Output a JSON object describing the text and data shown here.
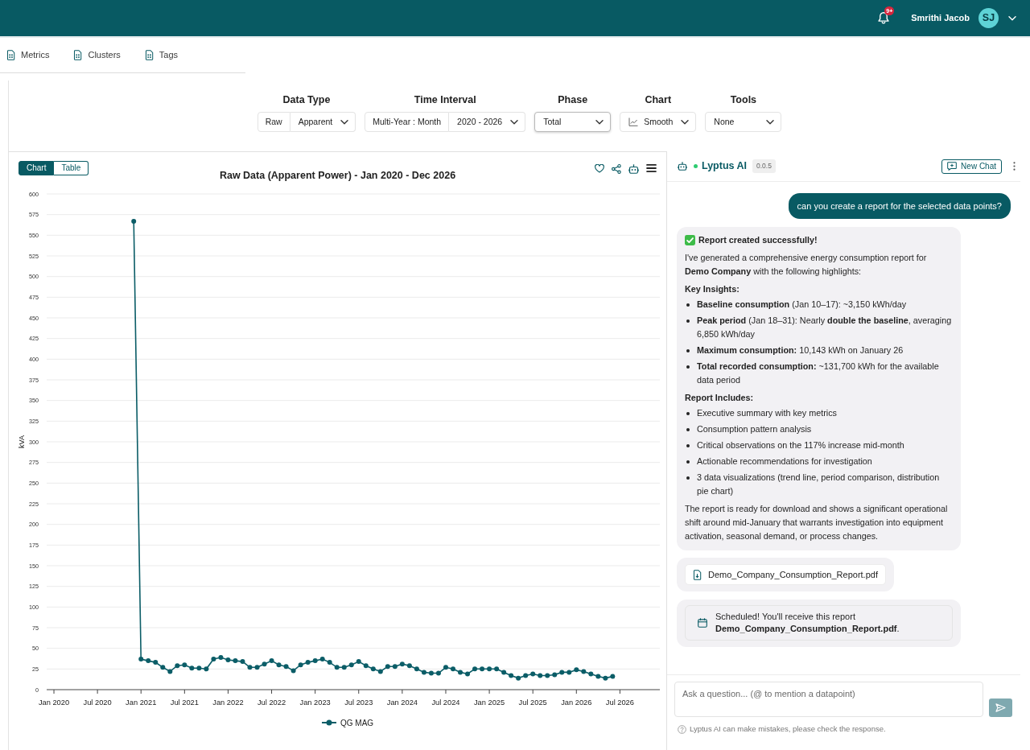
{
  "header": {
    "notification_count": "9+",
    "user_name": "Smrithi Jacob",
    "avatar_initials": "SJ"
  },
  "nav_tabs": [
    {
      "label": "Metrics"
    },
    {
      "label": "Clusters"
    },
    {
      "label": "Tags"
    }
  ],
  "filters": [
    {
      "label": "Data Type",
      "controls": [
        {
          "kind": "label",
          "text": "Raw"
        },
        {
          "kind": "select",
          "text": "Apparent",
          "focused": false
        }
      ]
    },
    {
      "label": "Time Interval",
      "controls": [
        {
          "kind": "label",
          "text": "Multi-Year : Month"
        },
        {
          "kind": "select",
          "text": "2020 - 2026",
          "focused": false
        }
      ]
    },
    {
      "label": "Phase",
      "controls": [
        {
          "kind": "select",
          "text": "Total",
          "focused": true
        }
      ]
    },
    {
      "label": "Chart",
      "controls": [
        {
          "kind": "chart-select",
          "text": "Smooth",
          "focused": false
        }
      ]
    },
    {
      "label": "Tools",
      "controls": [
        {
          "kind": "select",
          "text": "None",
          "focused": false
        }
      ]
    }
  ],
  "chart_panel": {
    "view_toggle": [
      {
        "label": "Chart",
        "selected": true
      },
      {
        "label": "Table",
        "selected": false
      }
    ],
    "chart_data": {
      "type": "line",
      "title": "Raw Data (Apparent Power) - Jan 2020 - Dec 2026",
      "ylabel": "kVA",
      "grid": true,
      "categories": [
        "Jan 2020",
        null,
        null,
        null,
        null,
        null,
        "Jul 2020",
        null,
        null,
        null,
        null,
        null,
        "Jan 2021",
        null,
        null,
        null,
        null,
        null,
        "Jul 2021",
        null,
        null,
        null,
        null,
        null,
        "Jan 2022",
        null,
        null,
        null,
        null,
        null,
        "Jul 2022",
        null,
        null,
        null,
        null,
        null,
        "Jan 2023",
        null,
        null,
        null,
        null,
        null,
        "Jul 2023",
        null,
        null,
        null,
        null,
        null,
        "Jan 2024",
        null,
        null,
        null,
        null,
        null,
        "Jul 2024",
        null,
        null,
        null,
        null,
        null,
        "Jan 2025",
        null,
        null,
        null,
        null,
        null,
        "Jul 2025",
        null,
        null,
        null,
        null,
        null,
        "Jan 2026",
        null,
        null,
        null,
        null,
        null,
        "Jul 2026"
      ],
      "ylim": [
        0,
        600
      ],
      "yticks": [
        0,
        25,
        50,
        75,
        100,
        125,
        150,
        175,
        200,
        225,
        250,
        275,
        300,
        325,
        350,
        375,
        400,
        425,
        450,
        475,
        500,
        525,
        550,
        575,
        600
      ],
      "series": [
        {
          "name": "QG MAG",
          "color": "#0b5d67",
          "marker": "circle",
          "values": [
            null,
            null,
            null,
            null,
            null,
            null,
            null,
            null,
            null,
            null,
            null,
            567,
            37,
            35,
            33,
            27,
            22,
            29,
            30,
            26,
            26,
            25,
            37,
            39,
            36,
            35,
            34,
            27,
            27,
            31,
            35,
            30,
            28,
            23,
            30,
            33,
            35,
            37,
            33,
            27,
            27,
            30,
            34,
            29,
            25,
            22,
            28,
            28,
            31,
            29,
            25,
            21,
            20,
            20,
            27,
            25,
            21,
            19,
            25,
            25,
            25,
            25,
            21,
            17,
            14,
            17,
            19,
            17,
            17,
            18,
            21,
            21,
            24,
            22,
            19,
            16,
            14,
            16,
            null
          ]
        }
      ]
    }
  },
  "assistant": {
    "name": "Lyptus AI",
    "online": true,
    "version": "0.0.5",
    "new_chat_label": "New Chat",
    "messages": [
      {
        "kind": "user",
        "text": "can you create a report for the selected data points?"
      },
      {
        "kind": "report",
        "blocks": [
          {
            "kind": "title",
            "text": "Report created successfully!"
          },
          {
            "kind": "paragraph",
            "text": "I've generated a comprehensive energy consumption report for **Demo Company** with the following highlights:"
          },
          {
            "kind": "heading",
            "text": "Key Insights:"
          },
          {
            "kind": "list",
            "items": [
              "**Baseline consumption** (Jan 10–17): ~3,150 kWh/day",
              "**Peak period** (Jan 18–31): Nearly **double the baseline**, averaging 6,850 kWh/day",
              "**Maximum consumption:** 10,143 kWh on January 26",
              "**Total recorded consumption:** ~131,700 kWh for the available data period"
            ]
          },
          {
            "kind": "heading",
            "text": "Report Includes:"
          },
          {
            "kind": "list",
            "items": [
              "Executive summary with key metrics",
              "Consumption pattern analysis",
              "Critical observations on the 117% increase mid-month",
              "Actionable recommendations for investigation",
              "3 data visualizations (trend line, period comparison, distribution pie chart)"
            ]
          },
          {
            "kind": "paragraph",
            "text": "The report is ready for download and shows a significant operational shift around mid-January that warrants investigation into equipment activation, seasonal demand, or process changes."
          }
        ]
      },
      {
        "kind": "file",
        "file_name": "Demo_Company_Consumption_Report.pdf"
      },
      {
        "kind": "scheduled",
        "text": "Scheduled! You'll receive this report **Demo_Company_Consumption_Report.pdf**."
      }
    ],
    "input": {
      "placeholder": "Ask a question... (@ to mention a datapoint)",
      "send_disabled": true
    },
    "disclaimer": "Lyptus AI can make mistakes, please check the response."
  }
}
